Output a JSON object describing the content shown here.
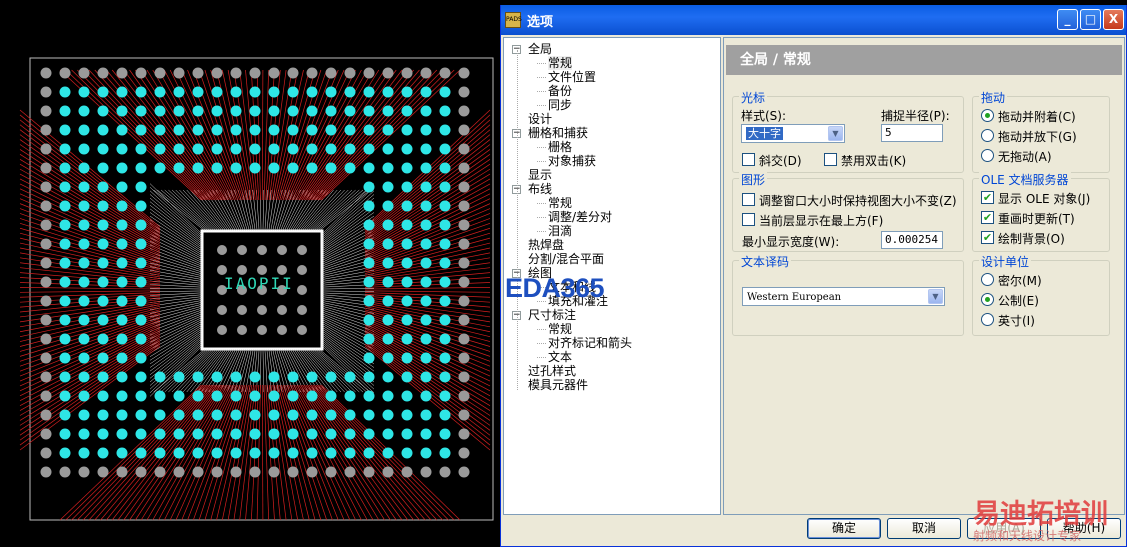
{
  "chip_label": "IAOPII",
  "watermark_eda": "EDA365",
  "watermark_cn1": "易迪拓培训",
  "watermark_cn2": "射频和天线设计专家",
  "dialog": {
    "title": "选项",
    "title_icon": "PADS",
    "min": "_",
    "max": "□",
    "close": "X"
  },
  "tree": {
    "items": [
      {
        "label": "全局",
        "level": 0,
        "expander": "−"
      },
      {
        "label": "常规",
        "level": 1,
        "selected": true
      },
      {
        "label": "文件位置",
        "level": 1
      },
      {
        "label": "备份",
        "level": 1
      },
      {
        "label": "同步",
        "level": 1
      },
      {
        "label": "设计",
        "level": 0
      },
      {
        "label": "栅格和捕获",
        "level": 0,
        "expander": "−"
      },
      {
        "label": "栅格",
        "level": 1
      },
      {
        "label": "对象捕获",
        "level": 1
      },
      {
        "label": "显示",
        "level": 0
      },
      {
        "label": "布线",
        "level": 0,
        "expander": "−"
      },
      {
        "label": "常规",
        "level": 1
      },
      {
        "label": "调整/差分对",
        "level": 1
      },
      {
        "label": "泪滴",
        "level": 1
      },
      {
        "label": "热焊盘",
        "level": 0
      },
      {
        "label": "分割/混合平面",
        "level": 0
      },
      {
        "label": "绘图",
        "level": 0,
        "expander": "−"
      },
      {
        "label": "文本和线",
        "level": 1
      },
      {
        "label": "填充和灌注",
        "level": 1
      },
      {
        "label": "尺寸标注",
        "level": 0,
        "expander": "−"
      },
      {
        "label": "常规",
        "level": 1
      },
      {
        "label": "对齐标记和箭头",
        "level": 1
      },
      {
        "label": "文本",
        "level": 1
      },
      {
        "label": "过孔样式",
        "level": 0
      },
      {
        "label": "模具元器件",
        "level": 0
      }
    ]
  },
  "panel": {
    "header": "全局 / 常规",
    "cursor": {
      "title": "光标",
      "style_label": "样式(S):",
      "style_value": "大十字",
      "snap_label": "捕捉半径(P):",
      "snap_value": "5",
      "diagonal_label": "斜交(D)",
      "diagonal_checked": false,
      "no_double_click_label": "禁用双击(K)",
      "no_double_click_checked": false
    },
    "drag": {
      "title": "拖动",
      "options": [
        "拖动并附着(C)",
        "拖动并放下(G)",
        "无拖动(A)"
      ],
      "selected": 0
    },
    "graphics": {
      "title": "图形",
      "keep_view_label": "调整窗口大小时保持视图大小不变(Z)",
      "keep_view_checked": false,
      "active_top_label": "当前层显示在最上方(F)",
      "active_top_checked": false,
      "min_width_label": "最小显示宽度(W):",
      "min_width_value": "0.000254"
    },
    "ole": {
      "title": "OLE 文档服务器",
      "options": [
        {
          "label": "显示 OLE 对象(J)",
          "checked": true
        },
        {
          "label": "重画时更新(T)",
          "checked": true
        },
        {
          "label": "绘制背景(O)",
          "checked": true
        }
      ]
    },
    "text_encoding": {
      "title": "文本译码",
      "value": "Western European"
    },
    "units": {
      "title": "设计单位",
      "options": [
        "密尔(M)",
        "公制(E)",
        "英寸(I)"
      ],
      "selected": 1
    }
  },
  "buttons": {
    "ok": "确定",
    "cancel": "取消",
    "apply": "应用(A)",
    "help": "帮助(H)"
  }
}
